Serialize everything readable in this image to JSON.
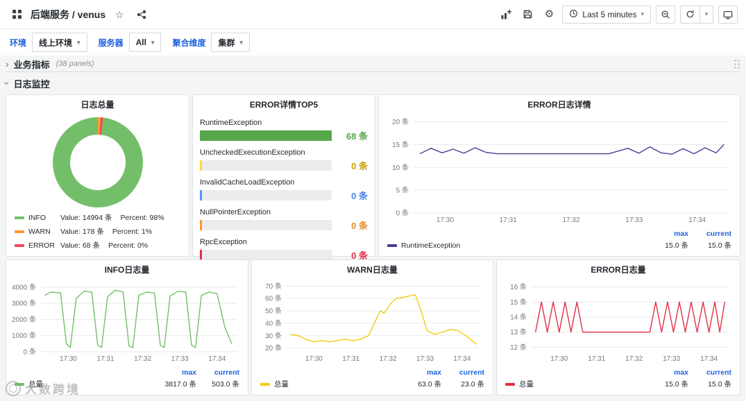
{
  "navbar": {
    "breadcrumb": "后端服务 / venus",
    "time_range_label": "Last 5 minutes"
  },
  "icons": {
    "caret": "▾",
    "chevron": "›",
    "star": "☆",
    "gear": "⚙"
  },
  "filters": {
    "env": {
      "label": "环境",
      "value": "线上环境"
    },
    "server": {
      "label": "服务器",
      "value": "All"
    },
    "dimension": {
      "label": "聚合维度",
      "value": "集群"
    }
  },
  "rows": {
    "business": {
      "title": "业务指标",
      "panels_count": "(38 panels)"
    },
    "logs": {
      "title": "日志监控"
    }
  },
  "watermark": {
    "text": "大数跨境"
  },
  "colors": {
    "accent_blue": "#1f62e0",
    "info_green": "#73bf69",
    "warn_orange": "#ff9830",
    "error_red": "#e02f44",
    "yellow": "#fade2a"
  },
  "chart_data": [
    {
      "id": "log-total",
      "type": "pie",
      "title": "日志总量",
      "segments": [
        {
          "name": "WARN",
          "value": 178,
          "percent": 1,
          "color": "#ff9830"
        },
        {
          "name": "ERROR",
          "value": 68,
          "percent": 0,
          "color": "#f2495c"
        },
        {
          "name": "INFO",
          "value": 14994,
          "percent": 98,
          "color": "#73bf69"
        }
      ],
      "legend": [
        {
          "name": "INFO",
          "color": "#73bf69",
          "value_label": "Value: 14994 条",
          "percent_label": "Percent: 98%"
        },
        {
          "name": "WARN",
          "color": "#ff9830",
          "value_label": "Value: 178 条",
          "percent_label": "Percent: 1%"
        },
        {
          "name": "ERROR",
          "color": "#f2495c",
          "value_label": "Value: 68 条",
          "percent_label": "Percent: 0%"
        }
      ]
    },
    {
      "id": "error-top5",
      "type": "bar",
      "title": "ERROR详情TOP5",
      "rows": [
        {
          "label": "RuntimeException",
          "value_text": "68 条",
          "fraction": 1,
          "color": "#56a64b",
          "value_color": "#56a64b"
        },
        {
          "label": "UncheckedExecutionException",
          "value_text": "0 条",
          "fraction": 0.012,
          "color": "#fade2a",
          "value_color": "#cc9d00"
        },
        {
          "label": "InvalidCacheLoadException",
          "value_text": "0 条",
          "fraction": 0.012,
          "color": "#5794f2",
          "value_color": "#4f86ec"
        },
        {
          "label": "NullPointerException",
          "value_text": "0 条",
          "fraction": 0.012,
          "color": "#ff9830",
          "value_color": "#e58c27"
        },
        {
          "label": "RpcException",
          "value_text": "0 条",
          "fraction": 0.012,
          "color": "#e02f44",
          "value_color": "#e02f44"
        }
      ]
    },
    {
      "id": "error-detail",
      "type": "line",
      "title": "ERROR日志详情",
      "ylim": [
        0,
        21
      ],
      "yticks": [
        {
          "v": 0,
          "label": "0 条"
        },
        {
          "v": 5,
          "label": "5 条"
        },
        {
          "v": 10,
          "label": "10 条"
        },
        {
          "v": 15,
          "label": "15 条"
        },
        {
          "v": 20,
          "label": "20 条"
        }
      ],
      "xticks": [
        {
          "f": 0.1,
          "label": "17:30"
        },
        {
          "f": 0.3,
          "label": "17:31"
        },
        {
          "f": 0.5,
          "label": "17:32"
        },
        {
          "f": 0.7,
          "label": "17:33"
        },
        {
          "f": 0.9,
          "label": "17:34"
        }
      ],
      "series": [
        {
          "name": "RuntimeException",
          "color": "#433e99",
          "points": [
            [
              0.02,
              13
            ],
            [
              0.055,
              14.2
            ],
            [
              0.09,
              13.2
            ],
            [
              0.125,
              14
            ],
            [
              0.16,
              13.1
            ],
            [
              0.195,
              14.3
            ],
            [
              0.23,
              13.3
            ],
            [
              0.265,
              13
            ],
            [
              0.32,
              13
            ],
            [
              0.38,
              13
            ],
            [
              0.44,
              13
            ],
            [
              0.5,
              13
            ],
            [
              0.56,
              13
            ],
            [
              0.62,
              13
            ],
            [
              0.68,
              14.2
            ],
            [
              0.715,
              13.1
            ],
            [
              0.75,
              14.5
            ],
            [
              0.785,
              13.2
            ],
            [
              0.82,
              12.9
            ],
            [
              0.855,
              14.1
            ],
            [
              0.89,
              13
            ],
            [
              0.925,
              14.3
            ],
            [
              0.96,
              13.2
            ],
            [
              0.985,
              15
            ]
          ]
        }
      ],
      "legend": {
        "headers": [
          "max",
          "current"
        ],
        "values": [
          "15.0 条",
          "15.0 条"
        ]
      }
    },
    {
      "id": "info-volume",
      "type": "line",
      "title": "INFO日志量",
      "ylim": [
        0,
        4300
      ],
      "yticks": [
        {
          "v": 0,
          "label": "0 条"
        },
        {
          "v": 1000,
          "label": "1000 条"
        },
        {
          "v": 2000,
          "label": "2000 条"
        },
        {
          "v": 3000,
          "label": "3000 条"
        },
        {
          "v": 4000,
          "label": "4000 条"
        }
      ],
      "xticks": [
        {
          "f": 0.14,
          "label": "17:30"
        },
        {
          "f": 0.33,
          "label": "17:31"
        },
        {
          "f": 0.52,
          "label": "17:32"
        },
        {
          "f": 0.71,
          "label": "17:33"
        },
        {
          "f": 0.9,
          "label": "17:34"
        }
      ],
      "series": [
        {
          "name": "总量",
          "color": "#73bf69",
          "points": [
            [
              0.02,
              3500
            ],
            [
              0.05,
              3700
            ],
            [
              0.1,
              3650
            ],
            [
              0.13,
              500
            ],
            [
              0.15,
              260
            ],
            [
              0.18,
              3300
            ],
            [
              0.22,
              3750
            ],
            [
              0.26,
              3700
            ],
            [
              0.29,
              400
            ],
            [
              0.31,
              260
            ],
            [
              0.34,
              3400
            ],
            [
              0.38,
              3817
            ],
            [
              0.42,
              3700
            ],
            [
              0.45,
              350
            ],
            [
              0.47,
              260
            ],
            [
              0.5,
              3500
            ],
            [
              0.54,
              3700
            ],
            [
              0.58,
              3650
            ],
            [
              0.61,
              400
            ],
            [
              0.63,
              260
            ],
            [
              0.66,
              3450
            ],
            [
              0.7,
              3750
            ],
            [
              0.74,
              3700
            ],
            [
              0.77,
              400
            ],
            [
              0.79,
              260
            ],
            [
              0.82,
              3500
            ],
            [
              0.86,
              3700
            ],
            [
              0.9,
              3600
            ],
            [
              0.94,
              1500
            ],
            [
              0.975,
              503
            ]
          ]
        }
      ],
      "legend": {
        "headers": [
          "max",
          "current"
        ],
        "values": [
          "3817.0 条",
          "503.0 条"
        ]
      }
    },
    {
      "id": "warn-volume",
      "type": "line",
      "title": "WARN日志量",
      "ylim": [
        17,
        73
      ],
      "yticks": [
        {
          "v": 20,
          "label": "20 条"
        },
        {
          "v": 30,
          "label": "30 条"
        },
        {
          "v": 40,
          "label": "40 条"
        },
        {
          "v": 50,
          "label": "50 条"
        },
        {
          "v": 60,
          "label": "60 条"
        },
        {
          "v": 70,
          "label": "70 条"
        }
      ],
      "xticks": [
        {
          "f": 0.14,
          "label": "17:30"
        },
        {
          "f": 0.33,
          "label": "17:31"
        },
        {
          "f": 0.52,
          "label": "17:32"
        },
        {
          "f": 0.71,
          "label": "17:33"
        },
        {
          "f": 0.9,
          "label": "17:34"
        }
      ],
      "series": [
        {
          "name": "总量",
          "color": "#f2cc0c",
          "points": [
            [
              0.02,
              31
            ],
            [
              0.06,
              30
            ],
            [
              0.1,
              27
            ],
            [
              0.14,
              25
            ],
            [
              0.18,
              26
            ],
            [
              0.22,
              25
            ],
            [
              0.26,
              26
            ],
            [
              0.3,
              27
            ],
            [
              0.34,
              26
            ],
            [
              0.38,
              27
            ],
            [
              0.42,
              30
            ],
            [
              0.45,
              40
            ],
            [
              0.48,
              50
            ],
            [
              0.5,
              48
            ],
            [
              0.53,
              55
            ],
            [
              0.56,
              60
            ],
            [
              0.6,
              61
            ],
            [
              0.63,
              62
            ],
            [
              0.66,
              63
            ],
            [
              0.69,
              50
            ],
            [
              0.72,
              34
            ],
            [
              0.76,
              31
            ],
            [
              0.8,
              33
            ],
            [
              0.84,
              35
            ],
            [
              0.88,
              34
            ],
            [
              0.92,
              30
            ],
            [
              0.95,
              26
            ],
            [
              0.975,
              23
            ]
          ]
        }
      ],
      "legend": {
        "headers": [
          "max",
          "current"
        ],
        "values": [
          "63.0 条",
          "23.0 条"
        ]
      }
    },
    {
      "id": "error-volume",
      "type": "line",
      "title": "ERROR日志量",
      "ylim": [
        11.7,
        16.3
      ],
      "yticks": [
        {
          "v": 12,
          "label": "12 条"
        },
        {
          "v": 13,
          "label": "13 条"
        },
        {
          "v": 14,
          "label": "14 条"
        },
        {
          "v": 15,
          "label": "15 条"
        },
        {
          "v": 16,
          "label": "16 条"
        }
      ],
      "xticks": [
        {
          "f": 0.14,
          "label": "17:30"
        },
        {
          "f": 0.33,
          "label": "17:31"
        },
        {
          "f": 0.52,
          "label": "17:32"
        },
        {
          "f": 0.71,
          "label": "17:33"
        },
        {
          "f": 0.9,
          "label": "17:34"
        }
      ],
      "series": [
        {
          "name": "总量",
          "color": "#e02f44",
          "points": [
            [
              0.02,
              13
            ],
            [
              0.05,
              15
            ],
            [
              0.08,
              13
            ],
            [
              0.11,
              15
            ],
            [
              0.14,
              13
            ],
            [
              0.17,
              15
            ],
            [
              0.2,
              13
            ],
            [
              0.23,
              15
            ],
            [
              0.26,
              13
            ],
            [
              0.32,
              13
            ],
            [
              0.38,
              13
            ],
            [
              0.44,
              13
            ],
            [
              0.5,
              13
            ],
            [
              0.56,
              13
            ],
            [
              0.6,
              13
            ],
            [
              0.63,
              15
            ],
            [
              0.66,
              13
            ],
            [
              0.69,
              15
            ],
            [
              0.72,
              13
            ],
            [
              0.75,
              15
            ],
            [
              0.78,
              13
            ],
            [
              0.81,
              15
            ],
            [
              0.84,
              13
            ],
            [
              0.87,
              15
            ],
            [
              0.9,
              13
            ],
            [
              0.93,
              15
            ],
            [
              0.955,
              13
            ],
            [
              0.98,
              15
            ]
          ]
        }
      ],
      "legend": {
        "headers": [
          "max",
          "current"
        ],
        "values": [
          "15.0 条",
          "15.0 条"
        ]
      }
    }
  ]
}
